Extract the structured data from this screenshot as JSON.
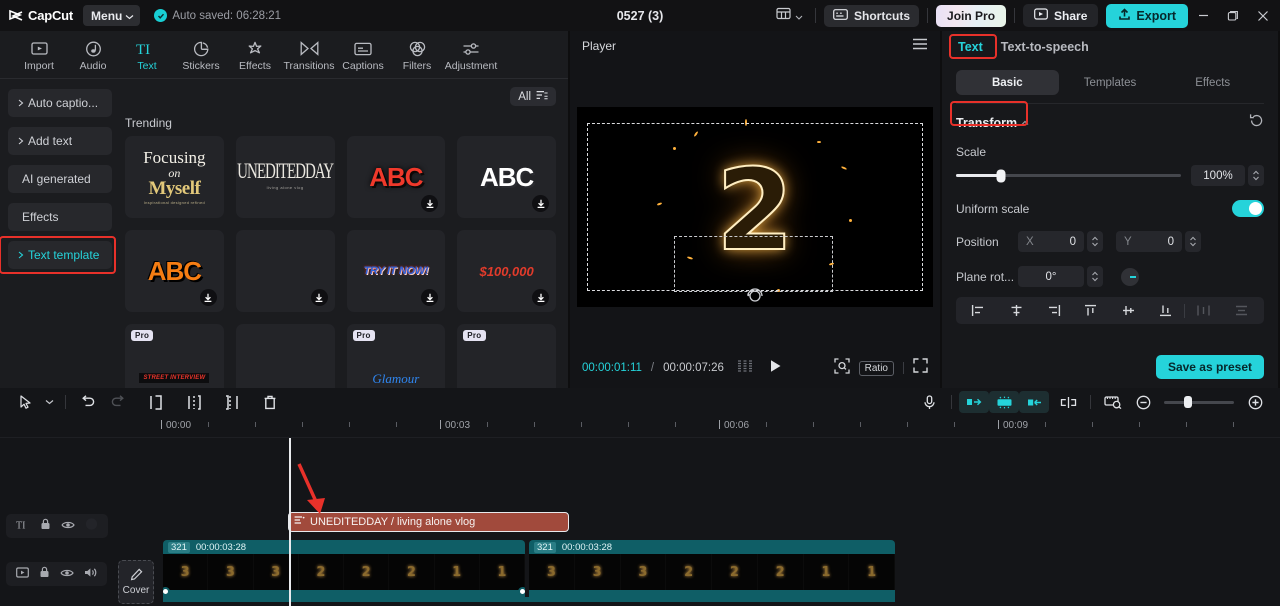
{
  "titlebar": {
    "brand": "CapCut",
    "menu_label": "Menu",
    "autosave": "Auto saved: 06:28:21",
    "project_title": "0527 (3)",
    "layout_icon": "layout-grid-icon",
    "shortcuts_label": "Shortcuts",
    "join_pro_label": "Join Pro",
    "share_label": "Share",
    "export_label": "Export",
    "minimize_label": "—",
    "maximize_label": "❐",
    "close_label": "✕"
  },
  "toolstrip": [
    {
      "label": "Import",
      "icon": "import-icon",
      "active": false
    },
    {
      "label": "Audio",
      "icon": "audio-icon",
      "active": false
    },
    {
      "label": "Text",
      "icon": "text-icon",
      "active": true
    },
    {
      "label": "Stickers",
      "icon": "stickers-icon",
      "active": false
    },
    {
      "label": "Effects",
      "icon": "effects-icon",
      "active": false
    },
    {
      "label": "Transitions",
      "icon": "transitions-icon",
      "active": false
    },
    {
      "label": "Captions",
      "icon": "captions-icon",
      "active": false
    },
    {
      "label": "Filters",
      "icon": "filters-icon",
      "active": false
    },
    {
      "label": "Adjustment",
      "icon": "adjustment-icon",
      "active": false
    }
  ],
  "sidenav": {
    "items": [
      {
        "label": "Auto captio...",
        "caret": true,
        "selected": false
      },
      {
        "label": "Add text",
        "caret": true,
        "selected": false
      },
      {
        "label": "AI generated",
        "caret": false,
        "selected": false
      },
      {
        "label": "Effects",
        "caret": false,
        "selected": false
      },
      {
        "label": "Text template",
        "caret": true,
        "selected": true
      }
    ]
  },
  "library": {
    "filter_label": "All",
    "filter_icon": "filter-icon",
    "section_title": "Trending",
    "templates": [
      {
        "kind": "focusing",
        "line1": "Focusing",
        "line2": "on",
        "line3": "Myself",
        "line4": "Inspirational designed refined",
        "download": false,
        "pro": false
      },
      {
        "kind": "unedit",
        "line1": "UNEDITEDDAY",
        "line2": "living alone vlog",
        "download": false,
        "pro": false
      },
      {
        "kind": "abc-red",
        "line1": "ABC",
        "download": true,
        "pro": false
      },
      {
        "kind": "abc-white",
        "line1": "ABC",
        "download": true,
        "pro": false
      },
      {
        "kind": "abc-orange",
        "line1": "ABC",
        "download": true,
        "pro": false
      },
      {
        "kind": "empty",
        "line1": "",
        "download": true,
        "pro": false
      },
      {
        "kind": "tryitnow",
        "line1": "TRY IT NOW!",
        "download": true,
        "pro": false
      },
      {
        "kind": "money",
        "line1": "$100,000",
        "download": true,
        "pro": false
      },
      {
        "kind": "street",
        "line1": "STREET INTERVIEW",
        "download": false,
        "pro": true,
        "pro_label": "Pro"
      },
      {
        "kind": "empty",
        "line1": "",
        "download": false,
        "pro": false
      },
      {
        "kind": "blue-script",
        "line1": "Glamour",
        "download": false,
        "pro": true,
        "pro_label": "Pro"
      },
      {
        "kind": "empty",
        "line1": "",
        "download": false,
        "pro": true,
        "pro_label": "Pro"
      }
    ]
  },
  "player": {
    "title": "Player",
    "menu_icon": "hamburger-icon",
    "preview_text": "2",
    "current_time": "00:00:01:11",
    "time_separator": "/",
    "total_time": "00:00:07:26",
    "frames_icon": "frames-icon",
    "play_icon": "play-icon",
    "zoom_icon": "zoom-fit-icon",
    "ratio_label": "Ratio",
    "fullscreen_icon": "fullscreen-icon",
    "rotate_icon": "rotate-handle-icon"
  },
  "properties": {
    "tabs": [
      {
        "label": "Text",
        "active": true
      },
      {
        "label": "Text-to-speech",
        "active": false
      }
    ],
    "segments": [
      {
        "label": "Basic",
        "active": true
      },
      {
        "label": "Templates",
        "active": false
      },
      {
        "label": "Effects",
        "active": false
      }
    ],
    "section": {
      "title": "Transform",
      "reset_icon": "reset-icon"
    },
    "scale": {
      "label": "Scale",
      "value": "100%"
    },
    "uniform_scale": {
      "label": "Uniform scale",
      "enabled": true
    },
    "position": {
      "label": "Position",
      "x_axis": "X",
      "x_value": "0",
      "y_axis": "Y",
      "y_value": "0"
    },
    "rotation": {
      "label": "Plane rot...",
      "value": "0°"
    },
    "align_buttons": [
      "align-left-icon",
      "align-center-h-icon",
      "align-right-icon",
      "align-top-icon",
      "align-middle-v-icon",
      "align-bottom-icon",
      "distribute-h-icon",
      "distribute-v-icon"
    ],
    "save_preset_label": "Save as preset"
  },
  "timeline": {
    "toolbar": {
      "select_icon": "select-arrow-icon",
      "select_caret": "chevron-down-icon",
      "undo_icon": "undo-icon",
      "redo_icon": "redo-icon",
      "split_icon": "split-icon",
      "trim_start_icon": "trim-start-icon",
      "trim_end_icon": "trim-end-icon",
      "delete_icon": "delete-icon",
      "mic_icon": "mic-icon",
      "mirror_icon": "mirror-icon",
      "freeze_icon": "freeze-icon",
      "crop_icon": "crop-icon",
      "keyframe_icon": "keyframe-icon",
      "preview_icon": "timeline-preview-icon",
      "zoom_out_icon": "zoom-out-icon",
      "zoom_in_icon": "zoom-in-icon"
    },
    "ruler_labels": [
      "00:00",
      "00:03",
      "00:06",
      "00:09"
    ],
    "text_track": {
      "header_icons": [
        "text-track-icon",
        "lock-icon",
        "eye-icon",
        "mute-placeholder-icon"
      ],
      "clip_label": "UNEDITEDDAY / living alone vlog",
      "clip_icon": "text-lines-icon"
    },
    "video_track": {
      "header_icons": [
        "video-track-icon",
        "lock-icon",
        "eye-icon",
        "volume-icon"
      ],
      "cover_label": "Cover",
      "cover_icon": "pencil-icon",
      "clips": [
        {
          "badge": "321",
          "duration": "00:00:03:28"
        },
        {
          "badge": "321",
          "duration": "00:00:03:28"
        }
      ]
    }
  },
  "annotations": {
    "highlight_color": "#e8312a",
    "boxes": [
      "text-template-nav",
      "text-tab",
      "transform-header"
    ],
    "arrow": "red-arrow-to-text-clip"
  }
}
